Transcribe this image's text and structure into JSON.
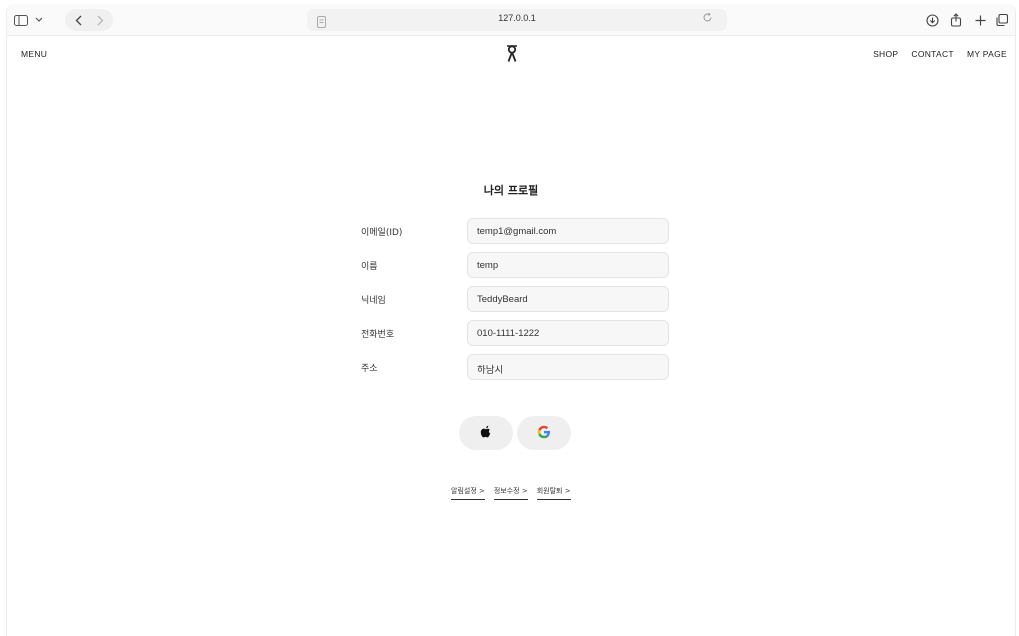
{
  "browser": {
    "url": "127.0.0.1",
    "icons": [
      "sidebar-icon",
      "chevron-down-icon",
      "back-icon",
      "forward-icon",
      "page-icon",
      "reload-icon",
      "download-icon",
      "share-icon",
      "new-tab-icon",
      "tabs-overview-icon"
    ]
  },
  "nav": {
    "menu": "MENU",
    "links": [
      "SHOP",
      "CONTACT",
      "MY PAGE"
    ]
  },
  "profile": {
    "title": "나의 프로필",
    "fields": [
      {
        "label": "이메일(ID)",
        "value": "temp1@gmail.com"
      },
      {
        "label": "이름",
        "value": "temp"
      },
      {
        "label": "닉네임",
        "value": "TeddyBeard"
      },
      {
        "label": "전화번호",
        "value": "010-1111-1222"
      },
      {
        "label": "주소",
        "value": "하남시"
      }
    ]
  },
  "social": {
    "icons": [
      "apple-icon",
      "google-icon"
    ],
    "google_colors": [
      "#4285F4",
      "#EA4335",
      "#FBBC05",
      "#34A853"
    ]
  },
  "links": [
    "알림설정 >",
    "정보수정 >",
    "회원탈퇴 >"
  ]
}
